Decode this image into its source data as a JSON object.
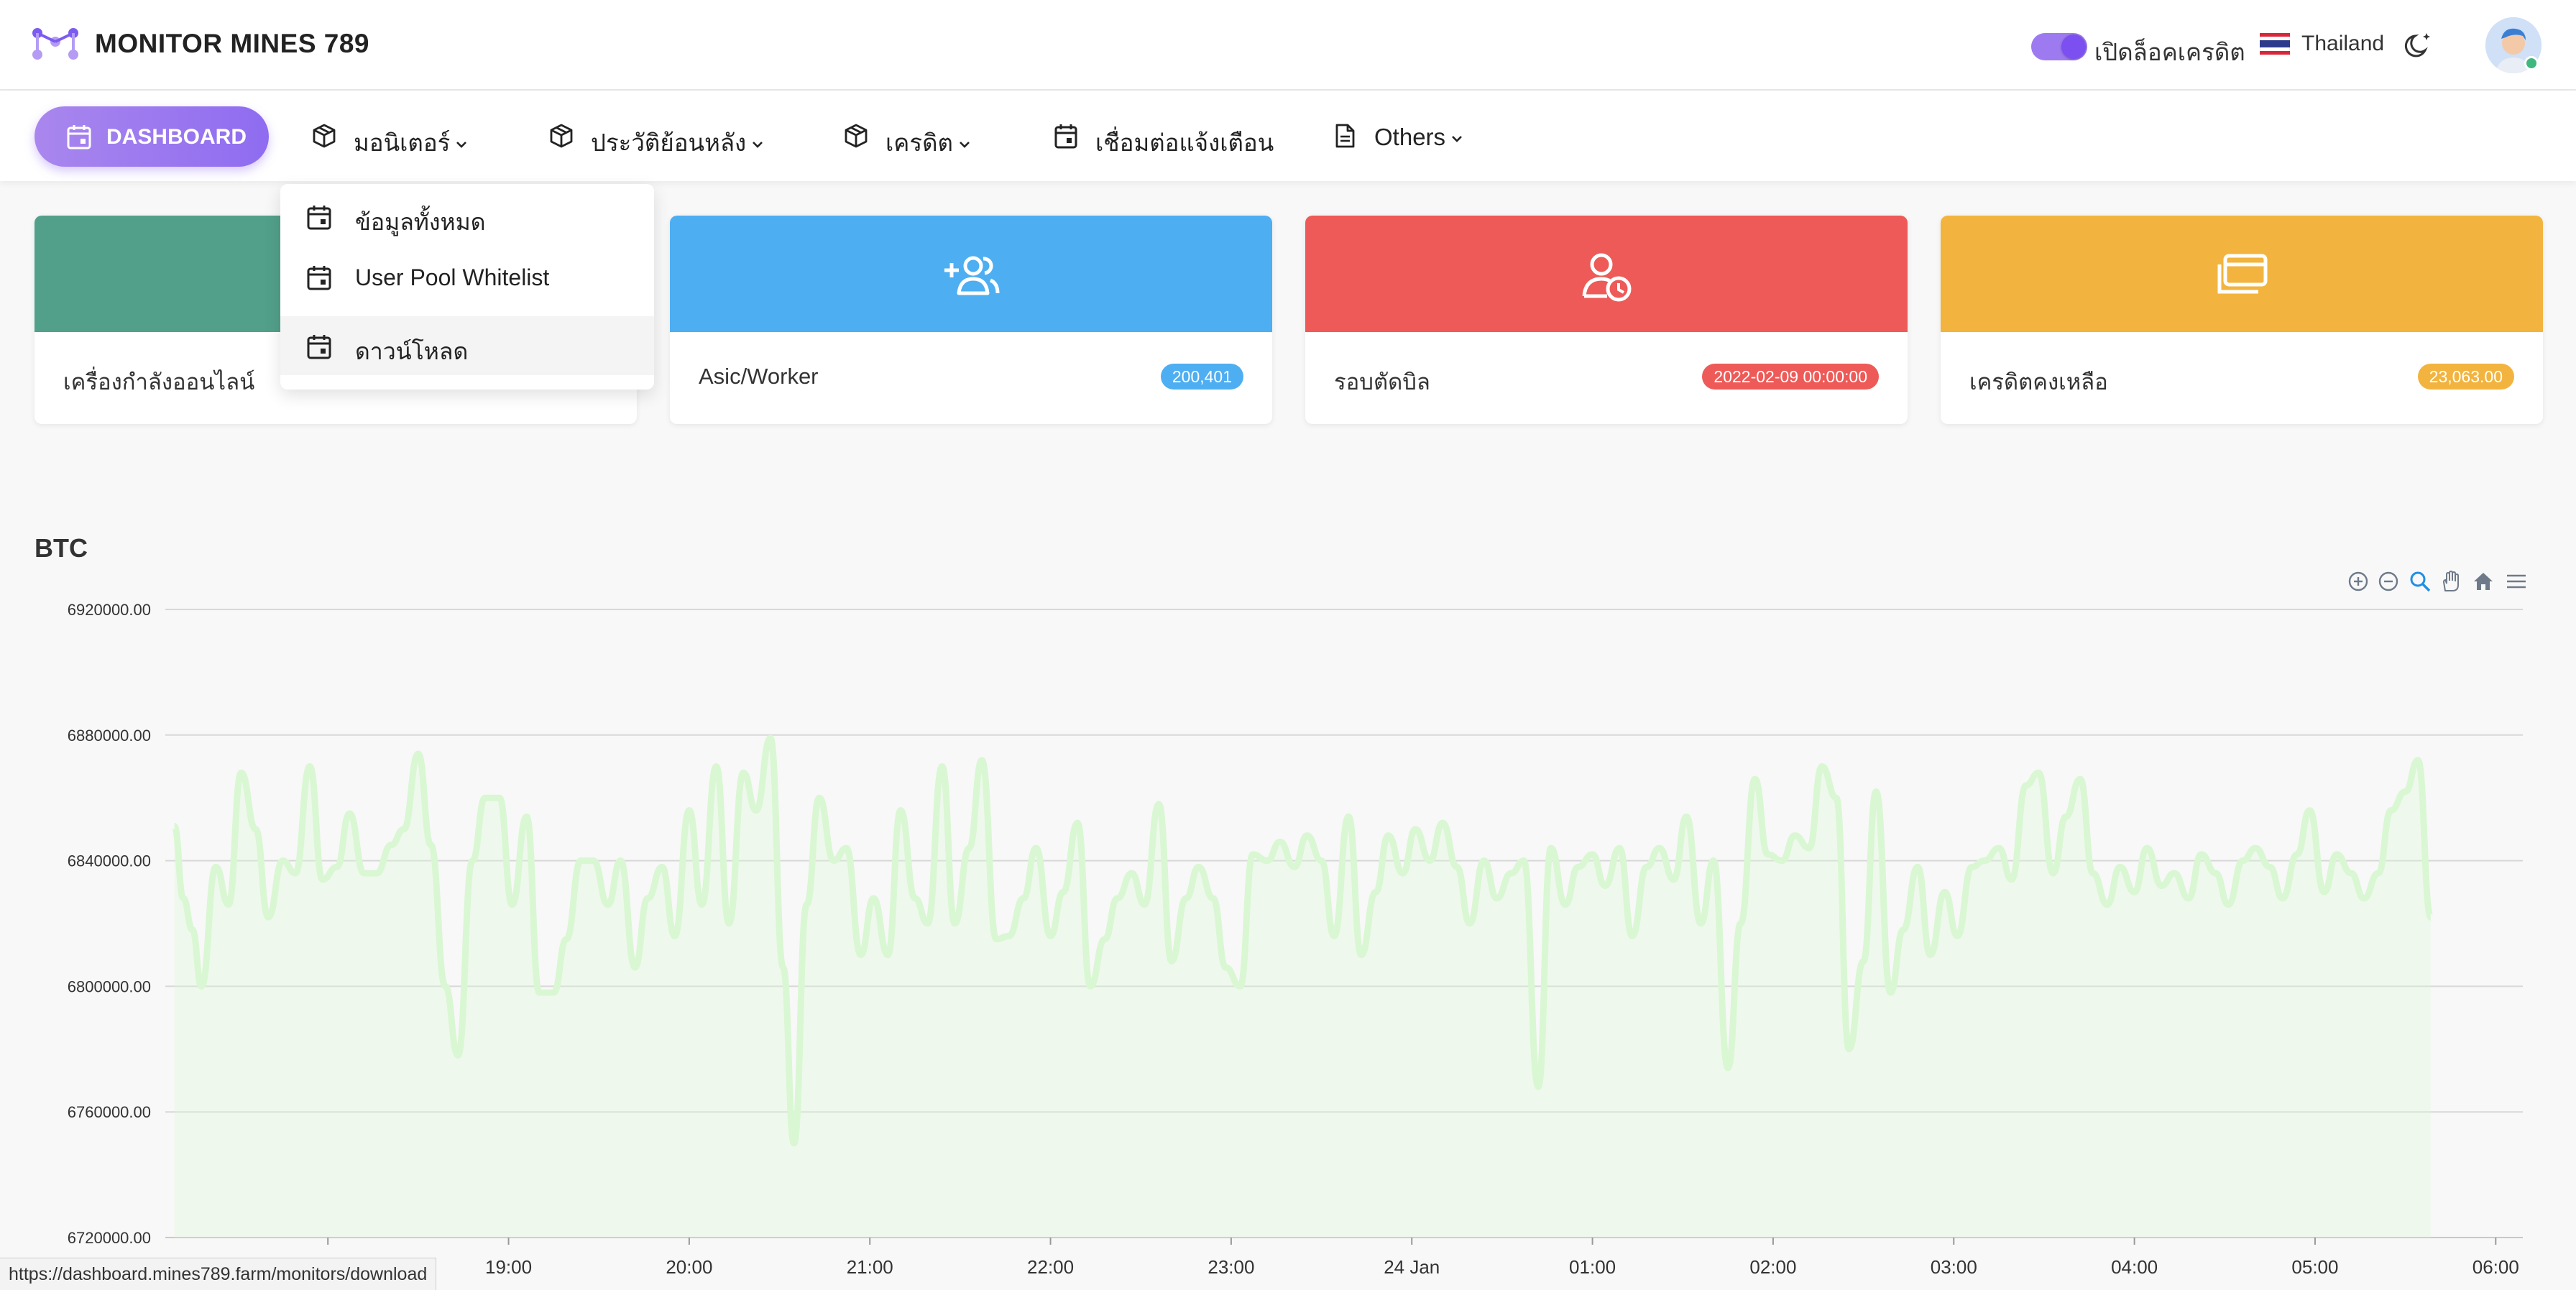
{
  "app": {
    "brand": "MONITOR MINES 789"
  },
  "header": {
    "credit_lock_label": "เปิดล็อคเครดิต",
    "credit_lock_on": true,
    "language": "Thailand"
  },
  "nav": {
    "dashboard": "DASHBOARD",
    "items": [
      {
        "label": "มอนิเตอร์",
        "has_dropdown": true,
        "icon": "box-icon"
      },
      {
        "label": "ประวัติย้อนหลัง",
        "has_dropdown": true,
        "icon": "box-icon"
      },
      {
        "label": "เครดิต",
        "has_dropdown": true,
        "icon": "box-icon"
      },
      {
        "label": "เชื่อมต่อแจ้งเตือน",
        "has_dropdown": false,
        "icon": "calendar-icon"
      },
      {
        "label": "Others",
        "has_dropdown": true,
        "icon": "document-icon"
      }
    ]
  },
  "dropdown": {
    "items": [
      {
        "label": "ข้อมูลทั้งหมด"
      },
      {
        "label": "User Pool Whitelist"
      },
      {
        "label": "ดาวน์โหลด",
        "hovered": true
      }
    ]
  },
  "cards": [
    {
      "title": "เครื่องกำลังออนไลน์",
      "badge": "",
      "color": "#52a08a",
      "icon": "online-icon"
    },
    {
      "title": "Asic/Worker",
      "badge": "200,401",
      "color": "#4eaef2",
      "icon": "add-users-icon"
    },
    {
      "title": "รอบตัดบิล",
      "badge": "2022-02-09 00:00:00",
      "color": "#ee5a57",
      "icon": "user-clock-icon"
    },
    {
      "title": "เครดิตคงเหลือ",
      "badge": "23,063.00",
      "color": "#f2b43e",
      "icon": "wallet-icon"
    }
  ],
  "chart_title": "BTC",
  "chart_data": {
    "type": "area",
    "title": "BTC",
    "ylim": [
      6720000,
      6920000
    ],
    "y_ticks": [
      "6920000.00",
      "6880000.00",
      "6840000.00",
      "6800000.00",
      "6760000.00",
      "6720000.00"
    ],
    "x_ticks": [
      "19:00",
      "20:00",
      "21:00",
      "22:00",
      "23:00",
      "24 Jan",
      "01:00",
      "02:00",
      "03:00",
      "04:00",
      "05:00",
      "06:00"
    ],
    "x_range_hours": [
      17.1,
      30.15
    ],
    "series": [
      {
        "color": "#d9f7d3",
        "points": [
          [
            17.15,
            6851000
          ],
          [
            17.2,
            6828000
          ],
          [
            17.25,
            6818000
          ],
          [
            17.3,
            6800000
          ],
          [
            17.38,
            6838000
          ],
          [
            17.45,
            6826000
          ],
          [
            17.52,
            6868000
          ],
          [
            17.6,
            6850000
          ],
          [
            17.67,
            6822000
          ],
          [
            17.75,
            6840000
          ],
          [
            17.82,
            6836000
          ],
          [
            17.9,
            6870000
          ],
          [
            17.97,
            6834000
          ],
          [
            18.05,
            6838000
          ],
          [
            18.12,
            6855000
          ],
          [
            18.2,
            6836000
          ],
          [
            18.27,
            6836000
          ],
          [
            18.35,
            6845000
          ],
          [
            18.42,
            6850000
          ],
          [
            18.5,
            6874000
          ],
          [
            18.57,
            6845000
          ],
          [
            18.65,
            6800000
          ],
          [
            18.72,
            6778000
          ],
          [
            18.8,
            6840000
          ],
          [
            18.87,
            6860000
          ],
          [
            18.95,
            6860000
          ],
          [
            19.02,
            6826000
          ],
          [
            19.1,
            6854000
          ],
          [
            19.17,
            6798000
          ],
          [
            19.25,
            6798000
          ],
          [
            19.32,
            6815000
          ],
          [
            19.4,
            6840000
          ],
          [
            19.47,
            6840000
          ],
          [
            19.55,
            6826000
          ],
          [
            19.62,
            6840000
          ],
          [
            19.7,
            6806000
          ],
          [
            19.77,
            6828000
          ],
          [
            19.85,
            6838000
          ],
          [
            19.92,
            6816000
          ],
          [
            20.0,
            6856000
          ],
          [
            20.07,
            6826000
          ],
          [
            20.15,
            6870000
          ],
          [
            20.22,
            6820000
          ],
          [
            20.3,
            6868000
          ],
          [
            20.37,
            6856000
          ],
          [
            20.45,
            6879000
          ],
          [
            20.52,
            6806000
          ],
          [
            20.58,
            6750000
          ],
          [
            20.65,
            6826000
          ],
          [
            20.72,
            6860000
          ],
          [
            20.8,
            6840000
          ],
          [
            20.87,
            6844000
          ],
          [
            20.95,
            6810000
          ],
          [
            21.02,
            6828000
          ],
          [
            21.1,
            6810000
          ],
          [
            21.17,
            6856000
          ],
          [
            21.25,
            6828000
          ],
          [
            21.32,
            6820000
          ],
          [
            21.4,
            6870000
          ],
          [
            21.47,
            6820000
          ],
          [
            21.55,
            6844000
          ],
          [
            21.62,
            6872000
          ],
          [
            21.7,
            6815000
          ],
          [
            21.77,
            6816000
          ],
          [
            21.85,
            6828000
          ],
          [
            21.92,
            6844000
          ],
          [
            22.0,
            6816000
          ],
          [
            22.07,
            6830000
          ],
          [
            22.15,
            6852000
          ],
          [
            22.22,
            6800000
          ],
          [
            22.3,
            6815000
          ],
          [
            22.37,
            6828000
          ],
          [
            22.45,
            6836000
          ],
          [
            22.52,
            6826000
          ],
          [
            22.6,
            6858000
          ],
          [
            22.67,
            6808000
          ],
          [
            22.75,
            6828000
          ],
          [
            22.82,
            6838000
          ],
          [
            22.9,
            6828000
          ],
          [
            22.97,
            6806000
          ],
          [
            23.05,
            6800000
          ],
          [
            23.12,
            6842000
          ],
          [
            23.2,
            6840000
          ],
          [
            23.27,
            6846000
          ],
          [
            23.35,
            6838000
          ],
          [
            23.42,
            6848000
          ],
          [
            23.5,
            6840000
          ],
          [
            23.57,
            6816000
          ],
          [
            23.65,
            6854000
          ],
          [
            23.72,
            6810000
          ],
          [
            23.8,
            6830000
          ],
          [
            23.87,
            6848000
          ],
          [
            23.95,
            6836000
          ],
          [
            24.02,
            6850000
          ],
          [
            24.1,
            6840000
          ],
          [
            24.17,
            6852000
          ],
          [
            24.25,
            6838000
          ],
          [
            24.32,
            6820000
          ],
          [
            24.4,
            6840000
          ],
          [
            24.47,
            6828000
          ],
          [
            24.55,
            6836000
          ],
          [
            24.62,
            6840000
          ],
          [
            24.7,
            6768000
          ],
          [
            24.77,
            6844000
          ],
          [
            24.85,
            6826000
          ],
          [
            24.92,
            6838000
          ],
          [
            25.0,
            6842000
          ],
          [
            25.07,
            6832000
          ],
          [
            25.15,
            6844000
          ],
          [
            25.22,
            6816000
          ],
          [
            25.3,
            6838000
          ],
          [
            25.37,
            6844000
          ],
          [
            25.45,
            6834000
          ],
          [
            25.52,
            6854000
          ],
          [
            25.6,
            6820000
          ],
          [
            25.67,
            6840000
          ],
          [
            25.75,
            6774000
          ],
          [
            25.82,
            6820000
          ],
          [
            25.9,
            6866000
          ],
          [
            25.97,
            6842000
          ],
          [
            26.05,
            6840000
          ],
          [
            26.12,
            6848000
          ],
          [
            26.2,
            6844000
          ],
          [
            26.27,
            6870000
          ],
          [
            26.35,
            6860000
          ],
          [
            26.42,
            6780000
          ],
          [
            26.5,
            6808000
          ],
          [
            26.57,
            6862000
          ],
          [
            26.65,
            6798000
          ],
          [
            26.72,
            6818000
          ],
          [
            26.8,
            6838000
          ],
          [
            26.87,
            6810000
          ],
          [
            26.95,
            6830000
          ],
          [
            27.02,
            6816000
          ],
          [
            27.1,
            6838000
          ],
          [
            27.17,
            6840000
          ],
          [
            27.25,
            6844000
          ],
          [
            27.32,
            6834000
          ],
          [
            27.4,
            6864000
          ],
          [
            27.47,
            6868000
          ],
          [
            27.55,
            6836000
          ],
          [
            27.62,
            6854000
          ],
          [
            27.7,
            6866000
          ],
          [
            27.77,
            6836000
          ],
          [
            27.85,
            6826000
          ],
          [
            27.92,
            6838000
          ],
          [
            28.0,
            6830000
          ],
          [
            28.07,
            6844000
          ],
          [
            28.15,
            6832000
          ],
          [
            28.22,
            6836000
          ],
          [
            28.3,
            6828000
          ],
          [
            28.37,
            6842000
          ],
          [
            28.45,
            6836000
          ],
          [
            28.52,
            6826000
          ],
          [
            28.6,
            6840000
          ],
          [
            28.67,
            6844000
          ],
          [
            28.75,
            6838000
          ],
          [
            28.82,
            6828000
          ],
          [
            28.9,
            6842000
          ],
          [
            28.97,
            6856000
          ],
          [
            29.05,
            6830000
          ],
          [
            29.12,
            6842000
          ],
          [
            29.2,
            6836000
          ],
          [
            29.27,
            6828000
          ],
          [
            29.35,
            6836000
          ],
          [
            29.42,
            6856000
          ],
          [
            29.5,
            6862000
          ],
          [
            29.57,
            6872000
          ],
          [
            29.64,
            6822000
          ]
        ]
      }
    ]
  },
  "status_url": "https://dashboard.mines789.farm/monitors/download"
}
